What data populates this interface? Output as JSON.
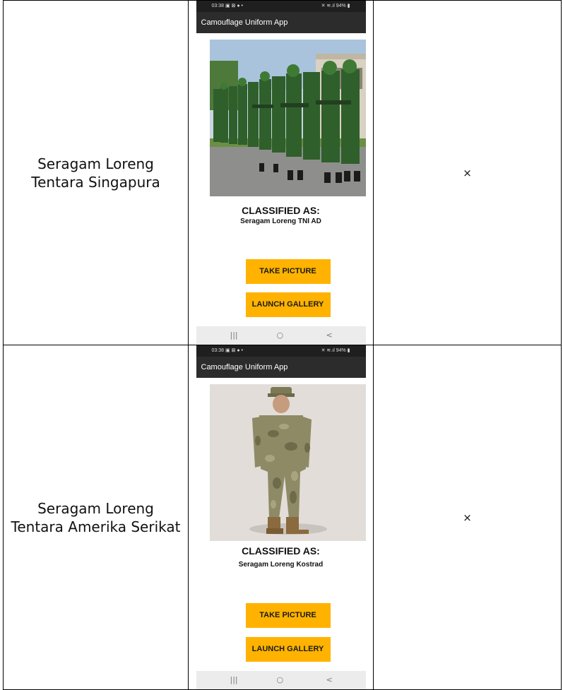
{
  "rows": [
    {
      "label_lines": [
        "Seragam Loreng",
        "Tentara Singapura"
      ],
      "mark": "×",
      "phone": {
        "status_time": "03:38 ▣ ⊠ ● •",
        "status_right": "✕ ≋.ıl 94% ▮",
        "app_title": "Camouflage Uniform App",
        "classified_title": "CLASSIFIED AS:",
        "classified_result": "Seragam Loreng TNI AD",
        "take_picture": "TAKE PICTURE",
        "launch_gallery": "LAUNCH GALLERY",
        "nav": [
          "|||",
          "○",
          "<"
        ]
      }
    },
    {
      "label_lines": [
        "Seragam Loreng",
        "Tentara Amerika Serikat"
      ],
      "mark": "×",
      "phone": {
        "status_time": "03:38 ▣ ⊠ ● •",
        "status_right": "✕ ≋.ıl 94% ▮",
        "app_title": "Camouflage Uniform App",
        "classified_title": "CLASSIFIED AS:",
        "classified_result": "Seragam Loreng Kostrad",
        "take_picture": "TAKE PICTURE",
        "launch_gallery": "LAUNCH GALLERY",
        "nav": [
          "|||",
          "○",
          "<"
        ]
      }
    }
  ],
  "colors": {
    "button": "#ffb300",
    "appbar": "#2c2c2c",
    "statusbar": "#1f1f1f",
    "navbar": "#ececec"
  }
}
